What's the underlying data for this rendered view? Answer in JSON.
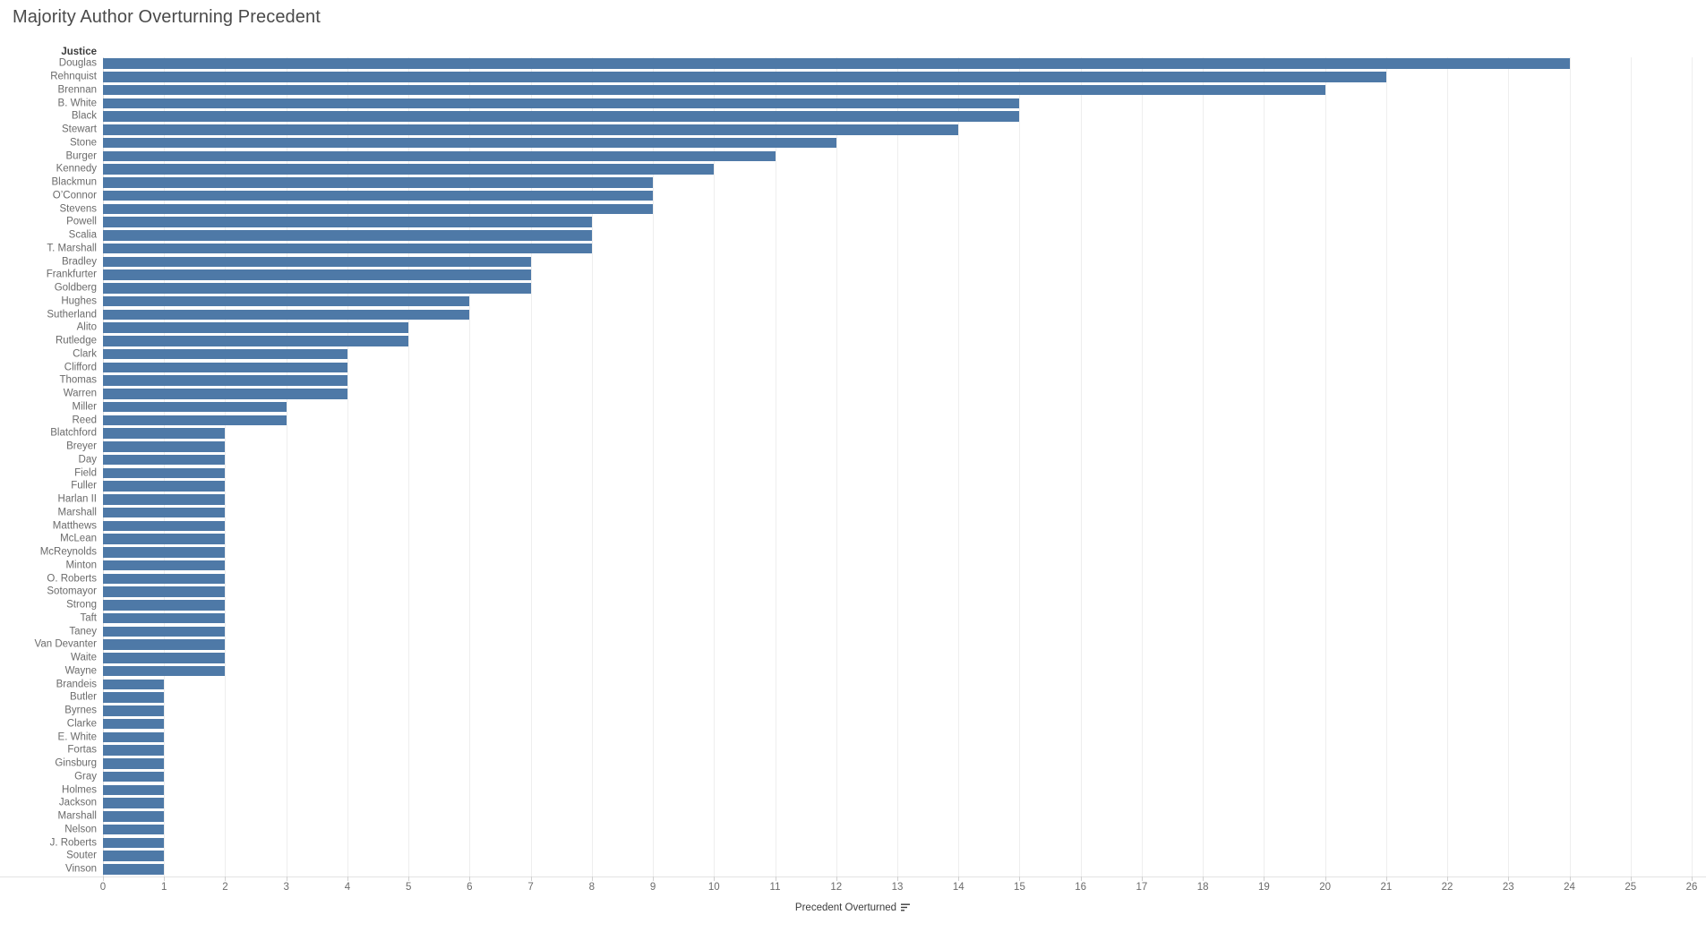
{
  "title": "Majority Author Overturning Precedent",
  "row_field_header": "Justice",
  "x_axis": {
    "title": "Precedent Overturned",
    "sort_icon": "sort-descending-icon",
    "min": 0,
    "max": 26,
    "tick_step": 1,
    "ticks": [
      0,
      1,
      2,
      3,
      4,
      5,
      6,
      7,
      8,
      9,
      10,
      11,
      12,
      13,
      14,
      15,
      16,
      17,
      18,
      19,
      20,
      21,
      22,
      23,
      24,
      25,
      26
    ]
  },
  "colors": {
    "bar": "#4e79a7",
    "title_text": "#4a4a4a",
    "label_text": "#6b6b6b",
    "header_text": "#3c3c3c",
    "gridline": "#eeeeee",
    "background": "#ffffff"
  },
  "chart_data": {
    "type": "bar",
    "orientation": "horizontal",
    "title": "Majority Author Overturning Precedent",
    "xlabel": "Precedent Overturned",
    "ylabel": "Justice",
    "xlim": [
      0,
      26
    ],
    "grid": true,
    "legend": "none",
    "sort": "descending by value",
    "categories": [
      "Douglas",
      "Rehnquist",
      "Brennan",
      "B. White",
      "Black",
      "Stewart",
      "Stone",
      "Burger",
      "Kennedy",
      "Blackmun",
      "O’Connor",
      "Stevens",
      "Powell",
      "Scalia",
      "T. Marshall",
      "Bradley",
      "Frankfurter",
      "Goldberg",
      "Hughes",
      "Sutherland",
      "Alito",
      "Rutledge",
      "Clark",
      "Clifford",
      "Thomas",
      "Warren",
      "Miller",
      "Reed",
      "Blatchford",
      "Breyer",
      "Day",
      "Field",
      "Fuller",
      "Harlan II",
      "Marshall",
      "Matthews",
      "McLean",
      "McReynolds",
      "Minton",
      "O. Roberts",
      "Sotomayor",
      "Strong",
      "Taft",
      "Taney",
      "Van Devanter",
      "Waite",
      "Wayne",
      "Brandeis",
      "Butler",
      "Byrnes",
      "Clarke",
      "E. White",
      "Fortas",
      "Ginsburg",
      "Gray",
      "Holmes",
      "Jackson",
      "Marshall",
      "Nelson",
      "J. Roberts",
      "Souter",
      "Vinson"
    ],
    "values": [
      24,
      21,
      20,
      15,
      15,
      14,
      12,
      11,
      10,
      9,
      9,
      9,
      8,
      8,
      8,
      7,
      7,
      7,
      6,
      6,
      5,
      5,
      4,
      4,
      4,
      4,
      3,
      3,
      2,
      2,
      2,
      2,
      2,
      2,
      2,
      2,
      2,
      2,
      2,
      2,
      2,
      2,
      2,
      2,
      2,
      2,
      2,
      1,
      1,
      1,
      1,
      1,
      1,
      1,
      1,
      1,
      1,
      1,
      1,
      1,
      1,
      1
    ]
  }
}
